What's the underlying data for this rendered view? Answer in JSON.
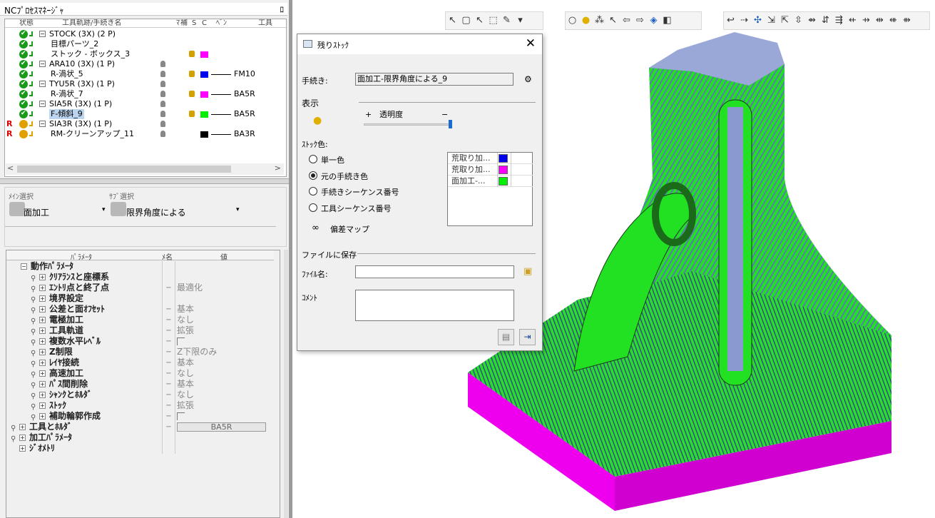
{
  "panel": {
    "title": "NCﾌﾟﾛｾｽﾏﾈｰｼﾞｬ",
    "pin": "ﾛ"
  },
  "tree": {
    "headers": [
      "状態",
      "工具軌跡/手続き名",
      "ﾏ",
      "補",
      "S",
      "C",
      "ﾍﾞﾝ",
      "工具"
    ],
    "rows": [
      {
        "name": "STOCK (3X) (2 P)",
        "status": "ok",
        "expand": "−",
        "tool": "",
        "color": ""
      },
      {
        "name": "目標パーツ_2",
        "status": "ok",
        "expand": "",
        "tool": "",
        "color": ""
      },
      {
        "name": "ストック - ボックス_3",
        "status": "ok",
        "expand": "",
        "tool": "",
        "color": "#ff00ff"
      },
      {
        "name": "ARA10 (3X) (1 P)",
        "status": "ok",
        "expand": "−",
        "tool": "",
        "color": ""
      },
      {
        "name": "R-渦状_5",
        "status": "ok",
        "expand": "",
        "tool": "FM10",
        "color": "#0000ee"
      },
      {
        "name": "TYU5R (3X) (1 P)",
        "status": "ok",
        "expand": "−",
        "tool": "",
        "color": ""
      },
      {
        "name": "R-渦状_7",
        "status": "ok",
        "expand": "",
        "tool": "BA5R",
        "color": "#ff00ff"
      },
      {
        "name": "SIA5R (3X) (1 P)",
        "status": "ok",
        "expand": "−",
        "tool": "",
        "color": ""
      },
      {
        "name": "F-傾斜_9",
        "status": "ok",
        "expand": "",
        "tool": "BA5R",
        "color": "#00ee00"
      },
      {
        "name": "SIA3R (3X) (1 P)",
        "status": "warn",
        "expand": "−",
        "tool": "",
        "color": ""
      },
      {
        "name": "RM-クリーンアップ_11",
        "status": "warn",
        "expand": "",
        "tool": "BA3R",
        "color": "#000000"
      }
    ]
  },
  "selection": {
    "main_label": "ﾒｲﾝ選択",
    "main_value": "面加工",
    "sub_label": "ｻﾌﾞ選択",
    "sub_value": "限界角度による"
  },
  "params": {
    "headers": [
      "ﾊﾟﾗﾒｰﾀ",
      "ﾒ名",
      "値"
    ],
    "rows": [
      {
        "label": "動作ﾊﾟﾗﾒｰﾀ",
        "c2": "",
        "c3": "",
        "indent": 1,
        "expand": "−",
        "key": false
      },
      {
        "label": "ｸﾘｱﾗﾝｽと座標系",
        "c2": "",
        "c3": "",
        "indent": 2,
        "expand": "+",
        "key": true
      },
      {
        "label": "ｴﾝﾄﾘ点と終了点",
        "c2": "−",
        "c3": "最適化",
        "indent": 2,
        "expand": "+",
        "key": true
      },
      {
        "label": "境界設定",
        "c2": "",
        "c3": "",
        "indent": 2,
        "expand": "+",
        "key": true
      },
      {
        "label": "公差と面ｵﾌｾｯﾄ",
        "c2": "−",
        "c3": "基本",
        "indent": 2,
        "expand": "+",
        "key": true
      },
      {
        "label": "電極加工",
        "c2": "−",
        "c3": "なし",
        "indent": 2,
        "expand": "+",
        "key": true
      },
      {
        "label": "工具軌道",
        "c2": "−",
        "c3": "拡張",
        "indent": 2,
        "expand": "+",
        "key": true
      },
      {
        "label": "複数水平ﾚﾍﾞﾙ",
        "c2": "−",
        "c3": "checkbox",
        "indent": 2,
        "expand": "+",
        "key": true
      },
      {
        "label": "Z制限",
        "c2": "−",
        "c3": "Z下限のみ",
        "indent": 2,
        "expand": "+",
        "key": true
      },
      {
        "label": "ﾚｲﾔ接続",
        "c2": "−",
        "c3": "基本",
        "indent": 2,
        "expand": "+",
        "key": true
      },
      {
        "label": "高速加工",
        "c2": "−",
        "c3": "なし",
        "indent": 2,
        "expand": "+",
        "key": true
      },
      {
        "label": "ﾊﾟｽ間削除",
        "c2": "−",
        "c3": "基本",
        "indent": 2,
        "expand": "+",
        "key": true
      },
      {
        "label": "ｼｬﾝｸとﾎﾙﾀﾞ",
        "c2": "−",
        "c3": "なし",
        "indent": 2,
        "expand": "+",
        "key": true
      },
      {
        "label": "ｽﾄｯｸ",
        "c2": "−",
        "c3": "拡張",
        "indent": 2,
        "expand": "+",
        "key": true
      },
      {
        "label": "補助輪郭作成",
        "c2": "−",
        "c3": "checkbox",
        "indent": 2,
        "expand": "+",
        "key": true
      },
      {
        "label": "工具とﾎﾙﾀﾞ",
        "c2": "−",
        "c3": "button:BA5R",
        "indent": 0,
        "expand": "+",
        "key": true
      },
      {
        "label": "加工ﾊﾟﾗﾒｰﾀ",
        "c2": "",
        "c3": "",
        "indent": 0,
        "expand": "+",
        "key": true
      },
      {
        "label": "ｼﾞｵﾒﾄﾘ",
        "c2": "",
        "c3": "",
        "indent": 0,
        "expand": "+",
        "key": false
      }
    ]
  },
  "dialog": {
    "title": "残りｽﾄｯｸ",
    "proc_label": "手続き:",
    "proc_value": "面加工-限界角度による_9",
    "display_label": "表示",
    "transparency_label": "透明度",
    "plus": "+",
    "minus": "−",
    "stock_color_label": "ｽﾄｯｸ色:",
    "radios": [
      {
        "label": "単一色",
        "checked": false
      },
      {
        "label": "元の手続き色",
        "checked": true
      },
      {
        "label": "手続きシーケンス番号",
        "checked": false
      },
      {
        "label": "工具シーケンス番号",
        "checked": false
      }
    ],
    "color_list": [
      {
        "name": "荒取り加...",
        "color": "#0000ee"
      },
      {
        "name": "荒取り加...",
        "color": "#ff00ff"
      },
      {
        "name": "面加工-...",
        "color": "#00ee00"
      }
    ],
    "deviation_label": "偏差マップ",
    "save_section": "ファイルに保存",
    "filename_label": "ﾌｧｲﾙ名:",
    "filename_value": "",
    "comment_label": "ｺﾒﾝﾄ",
    "comment_value": ""
  }
}
